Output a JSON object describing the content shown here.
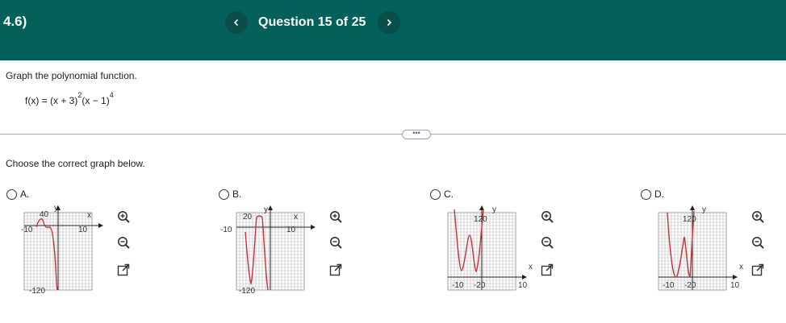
{
  "header": {
    "section": "4.6)",
    "question_label": "Question 15 of 25",
    "prev_icon": "chevron-left-icon",
    "next_icon": "chevron-right-icon",
    "bg_color": "#04605a"
  },
  "problem": {
    "instruction": "Graph the polynomial function.",
    "formula_parts": [
      "f(x) = (x + 3)",
      "2",
      "(x − 1)",
      "4"
    ],
    "more_label": "•••",
    "choose_label": "Choose the correct graph below."
  },
  "options": [
    {
      "letter": "A.",
      "xmin": "-10",
      "xmax": "10",
      "ytop": "40",
      "ybot": "-120",
      "xlabel": "x",
      "ylabel": "y",
      "curve_color": "#c8323b",
      "tools": [
        "zoom-in-icon",
        "zoom-out-icon",
        "open-external-icon"
      ]
    },
    {
      "letter": "B.",
      "xmin": "-10",
      "xmax": "10",
      "ytop": "20",
      "ybot": "-120",
      "xlabel": "x",
      "ylabel": "y",
      "curve_color": "#c8323b",
      "tools": [
        "zoom-in-icon",
        "zoom-out-icon",
        "open-external-icon"
      ]
    },
    {
      "letter": "C.",
      "xmin": "-10",
      "xmax": "10",
      "ytop": "120",
      "ybot": "-20",
      "xlabel": "x",
      "ylabel": "y",
      "curve_color": "#c8323b",
      "tools": [
        "zoom-in-icon",
        "zoom-out-icon",
        "open-external-icon"
      ]
    },
    {
      "letter": "D.",
      "xmin": "-10",
      "xmax": "10",
      "ytop": "120",
      "ybot": "-20",
      "xlabel": "x",
      "ylabel": "y",
      "curve_color": "#c8323b",
      "tools": [
        "zoom-in-icon",
        "zoom-out-icon",
        "open-external-icon"
      ]
    }
  ]
}
